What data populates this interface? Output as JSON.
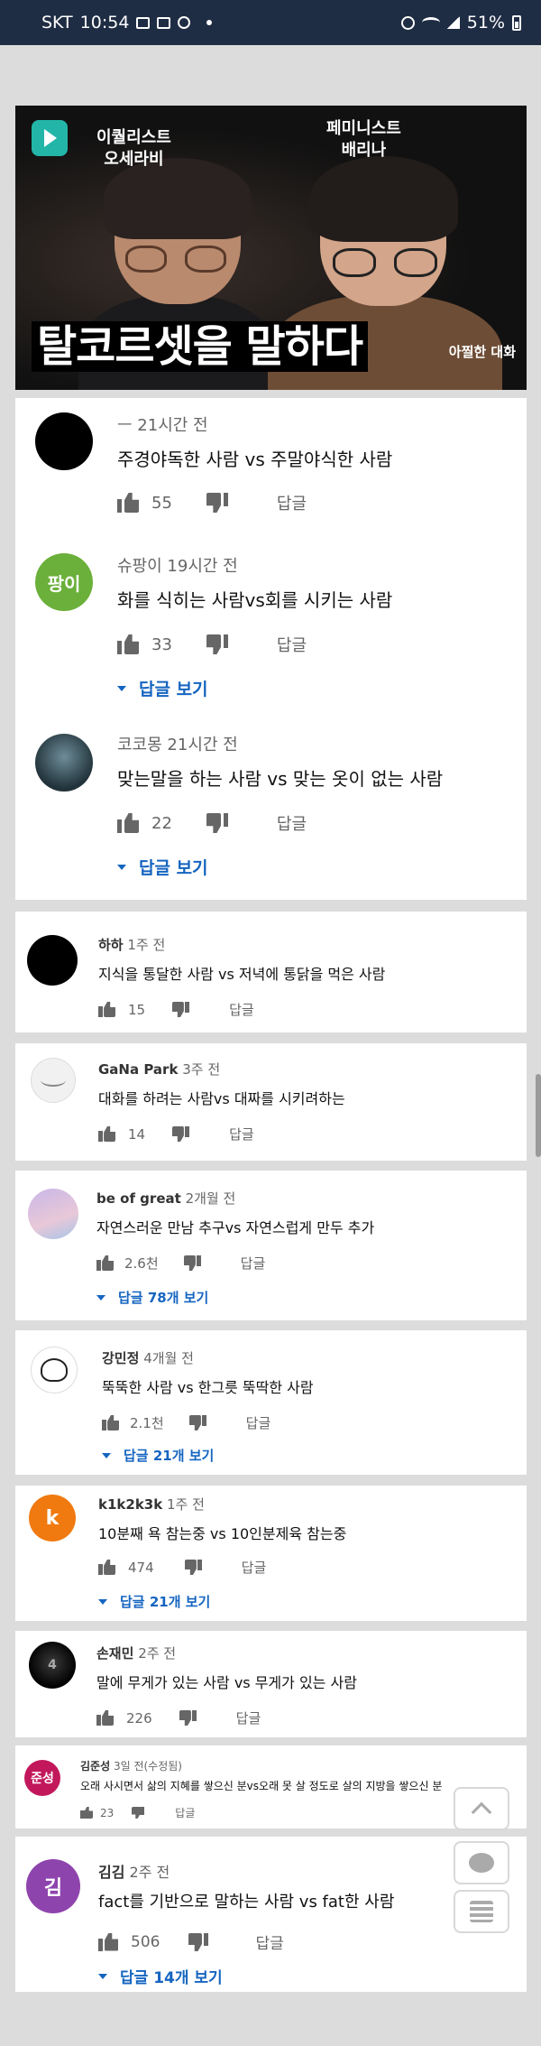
{
  "status_bar": {
    "carrier": "SKT",
    "time": "10:54",
    "battery": "51%"
  },
  "video": {
    "label_left": "이퀄리스트\n오세라비",
    "label_right": "페미니스트\n배리나",
    "title": "탈코르셋을 말하다",
    "subtitle": "아찔한 대화"
  },
  "comments": [
    {
      "author": "ㅡ",
      "time": "21시간 전",
      "text": "주경야독한 사람 vs 주말야식한 사람",
      "likes": "55",
      "reply_label": "답글",
      "view_replies": ""
    },
    {
      "author": "슈팡이",
      "time": "19시간 전",
      "text": "화를 식히는 사람vs회를 시키는 사람",
      "likes": "33",
      "reply_label": "답글",
      "view_replies": "답글 보기",
      "avatar_text": "팡이"
    },
    {
      "author": "코코몽",
      "time": "21시간 전",
      "text": "맞는말을 하는 사람 vs 맞는 옷이 없는 사람",
      "likes": "22",
      "reply_label": "답글",
      "view_replies": "답글 보기"
    },
    {
      "author": "하하",
      "time": "1주 전",
      "text": "지식을 통달한 사람 vs 저녁에 통닭을 먹은 사람",
      "likes": "15",
      "reply_label": "답글",
      "view_replies": ""
    },
    {
      "author": "GaNa Park",
      "time": "3주 전",
      "text": "대화를 하려는 사람vs 대짜를 시키려하는",
      "likes": "14",
      "reply_label": "답글",
      "view_replies": ""
    },
    {
      "author": "be of great",
      "time": "2개월 전",
      "text": "자연스러운 만남 추구vs 자연스럽게 만두 추가",
      "likes": "2.6천",
      "reply_label": "답글",
      "view_replies": "답글 78개 보기"
    },
    {
      "author": "강민정",
      "time": "4개월 전",
      "text": "뚝뚝한 사람 vs 한그릇 뚝딱한 사람",
      "likes": "2.1천",
      "reply_label": "답글",
      "view_replies": "답글 21개 보기"
    },
    {
      "author": "k1k2k3k",
      "time": "1주 전",
      "text": "10분째 욕 참는중 vs 10인분제육 참는중",
      "likes": "474",
      "reply_label": "답글",
      "view_replies": "답글 21개 보기",
      "avatar_text": "k"
    },
    {
      "author": "손재민",
      "time": "2주 전",
      "text": "말에 무게가 있는 사람 vs 무게가 있는 사람",
      "likes": "226",
      "reply_label": "답글",
      "view_replies": "",
      "avatar_text": "4"
    },
    {
      "author": "김준성",
      "time": "3일 전(수정됨)",
      "text": "오래 사시면서 삶의 지혜를 쌓으신 분vs오래 못 살 정도로 살의 지방을 쌓으신 분",
      "likes": "23",
      "reply_label": "답글",
      "view_replies": "",
      "avatar_text": "준성"
    },
    {
      "author": "김김",
      "time": "2주 전",
      "text": "fact를 기반으로 말하는 사람 vs fat한 사람",
      "likes": "506",
      "reply_label": "답글",
      "view_replies": "답글 14개 보기",
      "avatar_text": "김"
    }
  ],
  "colors": {
    "link": "#1565c0",
    "status_bar": "#1f2d44",
    "avatar_green": "#6bb03a",
    "avatar_orange": "#f07a10",
    "avatar_pink": "#c2185b",
    "avatar_purple": "#8e44ad"
  },
  "icons": [
    "like-icon",
    "dislike-icon",
    "chevron-up-icon",
    "chat-icon",
    "list-icon"
  ]
}
